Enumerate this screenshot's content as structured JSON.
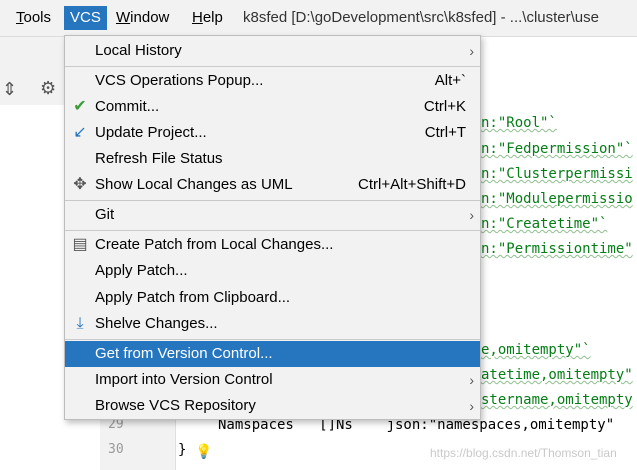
{
  "menubar": {
    "items": [
      {
        "label": "Tools",
        "underline": "T",
        "rest": "ools"
      },
      {
        "label": "VCS"
      },
      {
        "label": "Window",
        "underline": "W",
        "rest": "indow"
      },
      {
        "label": "Help",
        "underline": "H",
        "rest": "elp"
      }
    ],
    "title": "k8sfed [D:\\goDevelopment\\src\\k8sfed] - ...\\cluster\\use"
  },
  "vcs_menu": {
    "items": [
      {
        "label": "Local History",
        "arrow": "›"
      },
      {
        "label": "VCS Operations Popup...",
        "shortcut": "Alt+`"
      },
      {
        "label": "Commit...",
        "shortcut": "Ctrl+K",
        "icon": "✔"
      },
      {
        "label": "Update Project...",
        "shortcut": "Ctrl+T",
        "icon": "↙"
      },
      {
        "label": "Refresh File Status"
      },
      {
        "label": "Show Local Changes as UML",
        "shortcut": "Ctrl+Alt+Shift+D",
        "icon": "✥"
      },
      {
        "label": "Git",
        "arrow": "›"
      },
      {
        "label": "Create Patch from Local Changes...",
        "icon": "▤"
      },
      {
        "label": "Apply Patch..."
      },
      {
        "label": "Apply Patch from Clipboard..."
      },
      {
        "label": "Shelve Changes...",
        "icon": "⤓"
      },
      {
        "label": "Get from Version Control..."
      },
      {
        "label": "Import into Version Control",
        "arrow": "›"
      },
      {
        "label": "Browse VCS Repository",
        "arrow": "›"
      }
    ]
  },
  "editor": {
    "line_numbers": [
      "29",
      "30"
    ],
    "code_lines": [
      "n:\"Rool\"`",
      "n:\"Fedpermission\"`",
      "n:\"Clusterpermissi",
      "n:\"Modulepermissio",
      "n:\"Createtime\"`",
      "n:\"Permissiontime\"",
      "e,omitempty\"`",
      "atetime,omitempty\"",
      "stername,omitempty",
      "Namspaces   []Ns    json:\"namespaces,omitempty\"",
      "}"
    ]
  },
  "watermark": "https://blog.csdn.net/Thomson_tian",
  "colors": {
    "accent": "#2675bf",
    "menu_bg": "#f2f2f2",
    "string": "#067d17"
  }
}
